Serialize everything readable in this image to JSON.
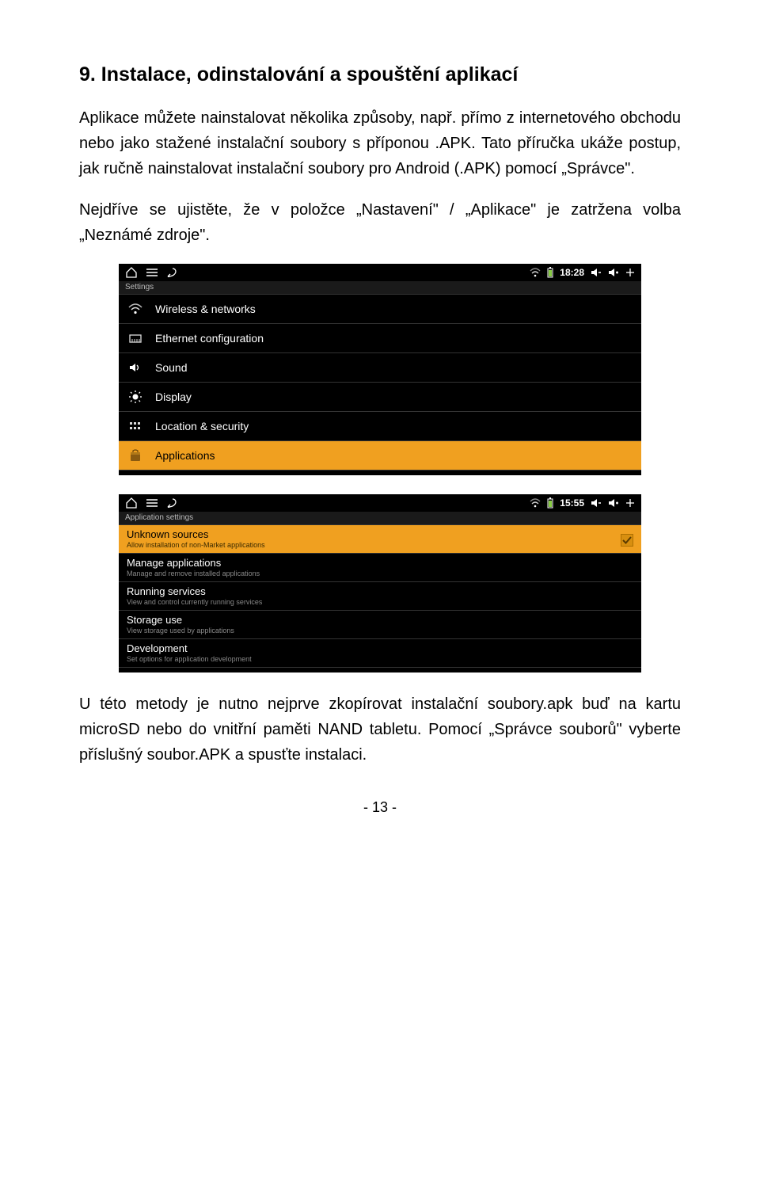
{
  "heading": "9. Instalace, odinstalování a spouštění aplikací",
  "para1": "Aplikace můžete nainstalovat několika způsoby, např. přímo z internetového obchodu nebo jako stažené instalační soubory s příponou .APK. Tato příručka ukáže postup, jak ručně nainstalovat instalační soubory pro Android (.APK) pomocí „Správce\".",
  "para2": "Nejdříve se ujistěte, že v položce „Nastavení\" / „Aplikace\" je zatržena volba „Neznámé zdroje\".",
  "para3": "U této metody je nutno nejprve zkopírovat instalační soubory.apk buď na kartu microSD nebo do vnitřní paměti NAND tabletu. Pomocí „Správce souborů\" vyberte příslušný soubor.APK a spusťte instalaci.",
  "pagenum": "- 13 -",
  "shot1": {
    "clock": "18:28",
    "section": "Settings",
    "rows": [
      {
        "label": "Wireless & networks",
        "icon": "wifi"
      },
      {
        "label": "Ethernet configuration",
        "icon": "ethernet"
      },
      {
        "label": "Sound",
        "icon": "sound"
      },
      {
        "label": "Display",
        "icon": "display"
      },
      {
        "label": "Location & security",
        "icon": "location"
      },
      {
        "label": "Applications",
        "icon": "apps",
        "selected": true
      }
    ]
  },
  "shot2": {
    "clock": "15:55",
    "section": "Application settings",
    "rows": [
      {
        "title": "Unknown sources",
        "sub": "Allow installation of non-Market applications",
        "selected": true,
        "check": true
      },
      {
        "title": "Manage applications",
        "sub": "Manage and remove installed applications"
      },
      {
        "title": "Running services",
        "sub": "View and control currently running services"
      },
      {
        "title": "Storage use",
        "sub": "View storage used by applications"
      },
      {
        "title": "Development",
        "sub": "Set options for application development"
      }
    ]
  }
}
